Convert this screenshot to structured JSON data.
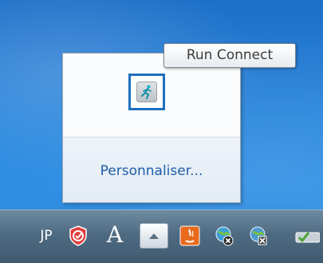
{
  "tooltip": {
    "text": "Run Connect"
  },
  "popup": {
    "app_icon": "run-connect-runner-icon",
    "customize_label": "Personnaliser..."
  },
  "taskbar": {
    "language": "JP",
    "ime_glyph": "A",
    "tray_icons": [
      "antivirus-shield-icon",
      "ime-mode-icon",
      "show-hidden-icons-button",
      "java-icon",
      "network-disconnected-icon",
      "network-error-icon",
      "safely-remove-hardware-icon"
    ]
  },
  "colors": {
    "accent": "#1e6fbf",
    "link": "#1c5fa8",
    "taskbar": "#4f6b82"
  }
}
